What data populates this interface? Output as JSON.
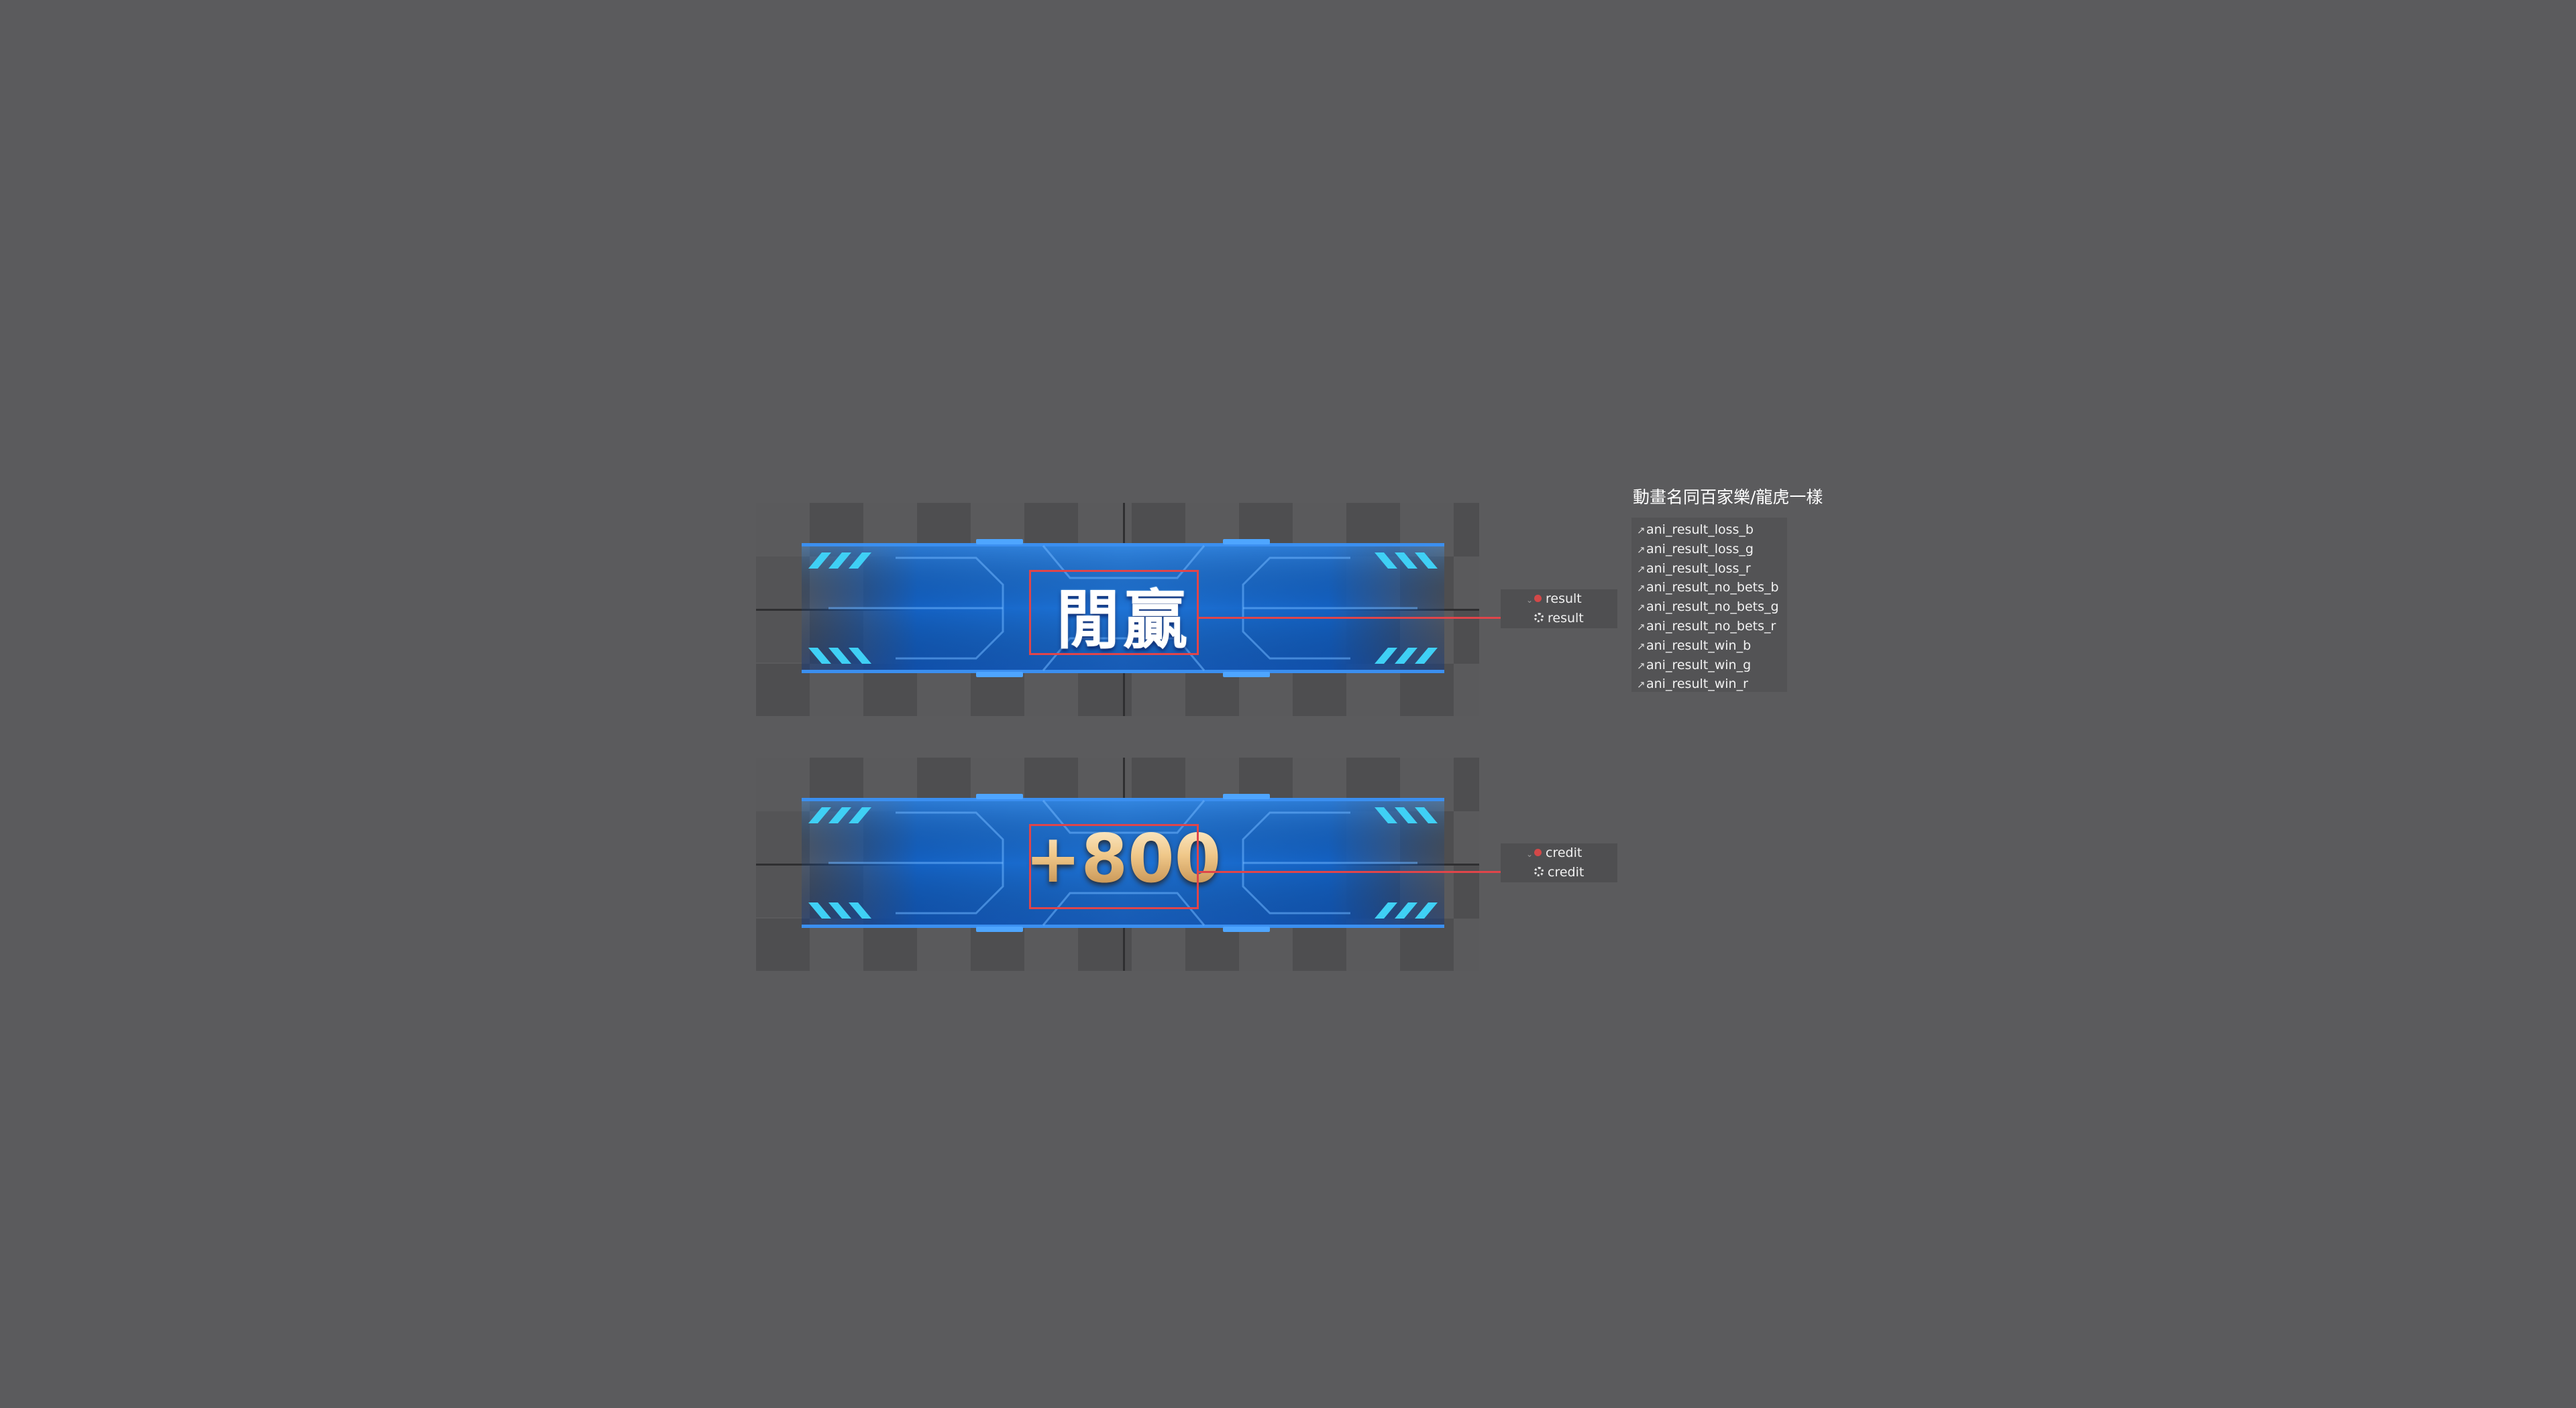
{
  "banners": {
    "result": {
      "text": "閒贏",
      "node_group_label": "result",
      "node_child_label": "result"
    },
    "credit": {
      "text": "+800",
      "node_group_label": "credit",
      "node_child_label": "credit"
    }
  },
  "animations": {
    "title": "動畫名同百家樂/龍虎一樣",
    "items": [
      "ani_result_loss_b",
      "ani_result_loss_g",
      "ani_result_loss_r",
      "ani_result_no_bets_b",
      "ani_result_no_bets_g",
      "ani_result_no_bets_r",
      "ani_result_win_b",
      "ani_result_win_g",
      "ani_result_win_r"
    ],
    "item_icon": "animation-clip-icon"
  },
  "colors": {
    "background": "#5b5b5d",
    "banner_blue": "#1e6fd0",
    "accent_cyan": "#3fd0f5",
    "highlight_red": "#e0454a",
    "credit_gold": "#e9c48e"
  }
}
